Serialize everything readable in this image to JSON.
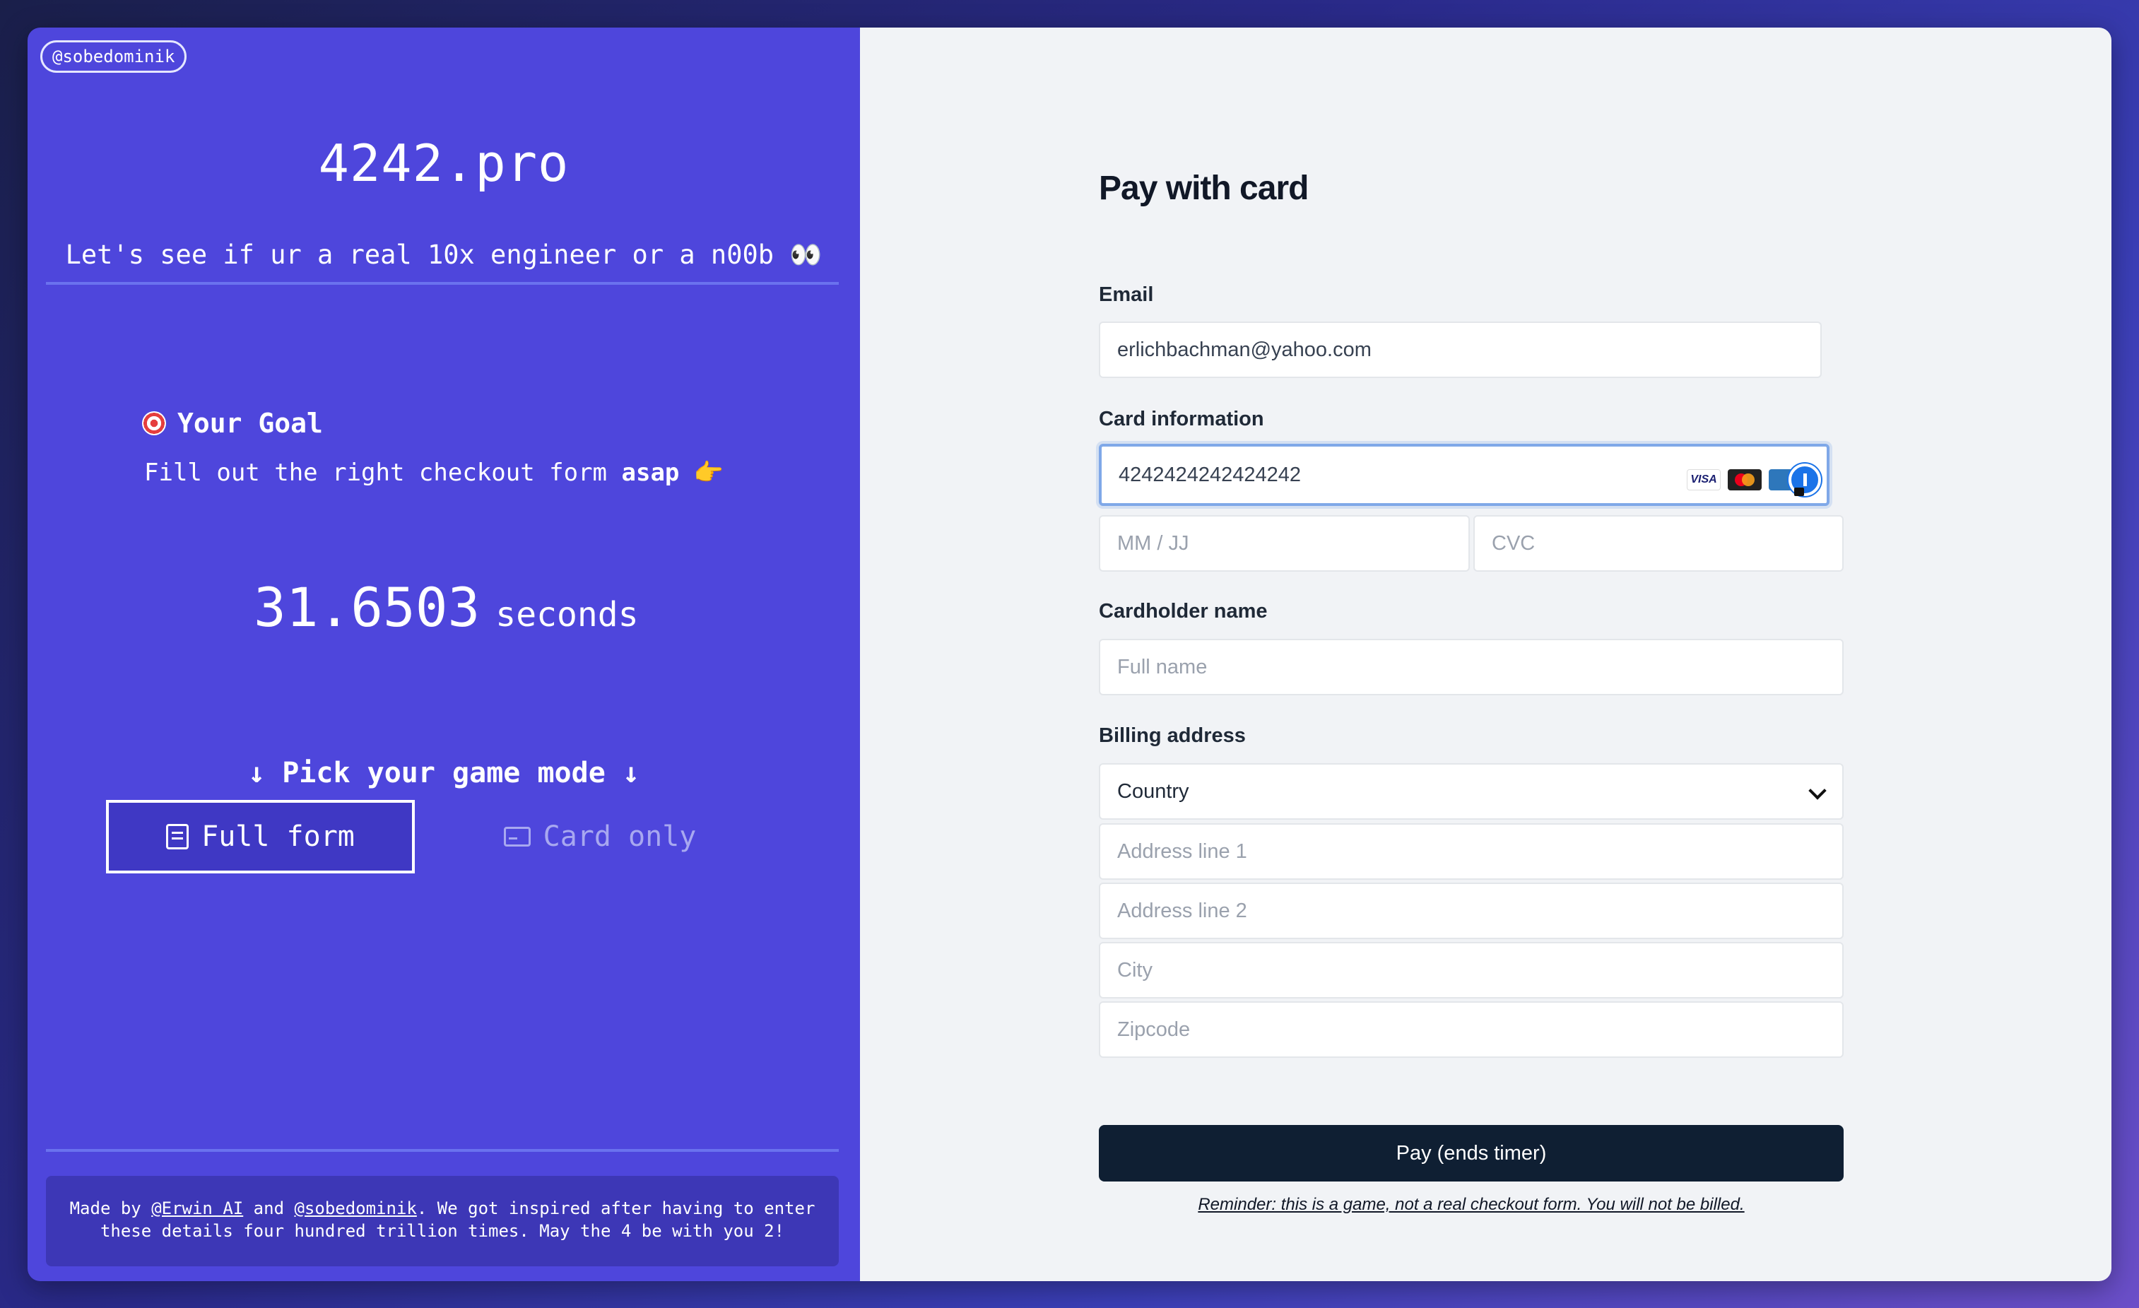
{
  "left": {
    "handle": "@sobedominik",
    "title": "4242.pro",
    "tagline": "Let's see if ur a real 10x engineer or a n00b 👀",
    "goal": {
      "heading": "Your Goal",
      "text_prefix": "Fill out the right checkout form ",
      "text_bold": "asap",
      "text_suffix": "👉"
    },
    "timer": {
      "value": "31.6503",
      "unit": "seconds"
    },
    "mode": {
      "heading": "↓ Pick your game mode ↓",
      "options": [
        {
          "label": "Full form",
          "active": true
        },
        {
          "label": "Card only",
          "active": false
        }
      ]
    },
    "footer": {
      "made_by": "Made by ",
      "link1": "@Erwin AI",
      "and": " and ",
      "link2": "@sobedominik",
      "rest": ". We got inspired after having to enter these details four hundred trillion times. May the 4 be with you 2!"
    }
  },
  "form": {
    "title": "Pay with card",
    "email": {
      "label": "Email",
      "value": "erlichbachman@yahoo.com"
    },
    "card": {
      "label": "Card information",
      "number": "4242424242424242",
      "expiry_placeholder": "MM / JJ",
      "cvc_placeholder": "CVC",
      "brands": [
        "visa-icon",
        "mastercard-icon",
        "amex-icon"
      ],
      "visa_text": "VISA"
    },
    "cardholder": {
      "label": "Cardholder name",
      "placeholder": "Full name"
    },
    "billing": {
      "label": "Billing address",
      "country": "Country",
      "line1": "Address line 1",
      "line2": "Address line 2",
      "city": "City",
      "zip": "Zipcode"
    },
    "pay_button": "Pay (ends timer)",
    "reminder": "Reminder: this is a game, not a real checkout form. You will not be billed."
  }
}
